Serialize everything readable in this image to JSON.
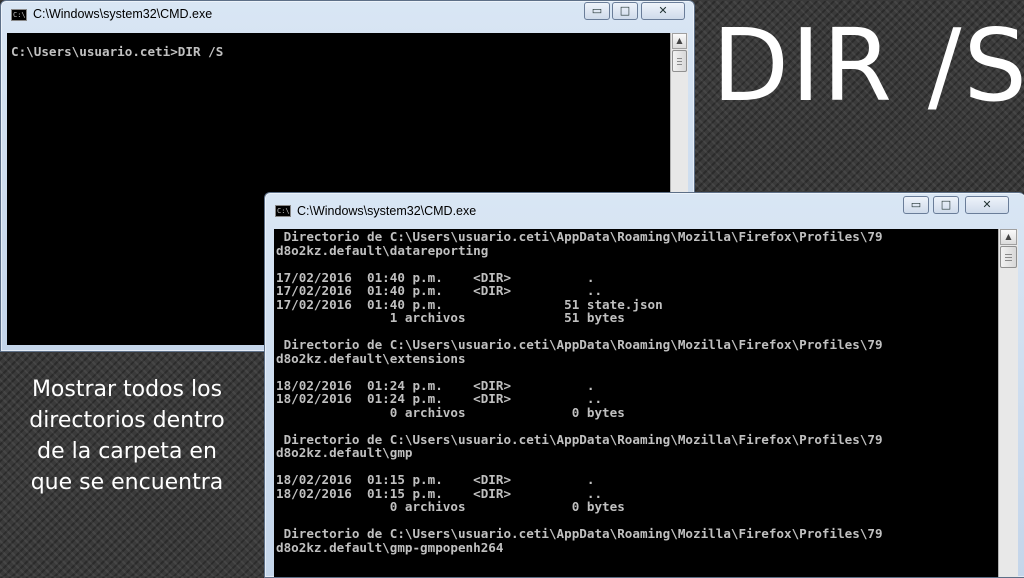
{
  "slide": {
    "title": "DIR /S",
    "caption": "Mostrar todos los directorios dentro de la carpeta en que se encuentra"
  },
  "window1": {
    "title": "C:\\Windows\\system32\\CMD.exe",
    "icon": "cmd-icon",
    "controls": {
      "minimize": "▭",
      "maximize": "□",
      "close": "✕"
    },
    "lines": [
      "C:\\Users\\usuario.ceti>DIR /S"
    ]
  },
  "window2": {
    "title": "C:\\Windows\\system32\\CMD.exe",
    "icon": "cmd-icon",
    "controls": {
      "minimize": "▭",
      "maximize": "□",
      "close": "✕"
    },
    "lines": [
      " Directorio de C:\\Users\\usuario.ceti\\AppData\\Roaming\\Mozilla\\Firefox\\Profiles\\79",
      "d8o2kz.default\\datareporting",
      "",
      "17/02/2016  01:40 p.m.    <DIR>          .",
      "17/02/2016  01:40 p.m.    <DIR>          ..",
      "17/02/2016  01:40 p.m.                51 state.json",
      "               1 archivos             51 bytes",
      "",
      " Directorio de C:\\Users\\usuario.ceti\\AppData\\Roaming\\Mozilla\\Firefox\\Profiles\\79",
      "d8o2kz.default\\extensions",
      "",
      "18/02/2016  01:24 p.m.    <DIR>          .",
      "18/02/2016  01:24 p.m.    <DIR>          ..",
      "               0 archivos              0 bytes",
      "",
      " Directorio de C:\\Users\\usuario.ceti\\AppData\\Roaming\\Mozilla\\Firefox\\Profiles\\79",
      "d8o2kz.default\\gmp",
      "",
      "18/02/2016  01:15 p.m.    <DIR>          .",
      "18/02/2016  01:15 p.m.    <DIR>          ..",
      "               0 archivos              0 bytes",
      "",
      " Directorio de C:\\Users\\usuario.ceti\\AppData\\Roaming\\Mozilla\\Firefox\\Profiles\\79",
      "d8o2kz.default\\gmp-gmpopenh264"
    ]
  }
}
